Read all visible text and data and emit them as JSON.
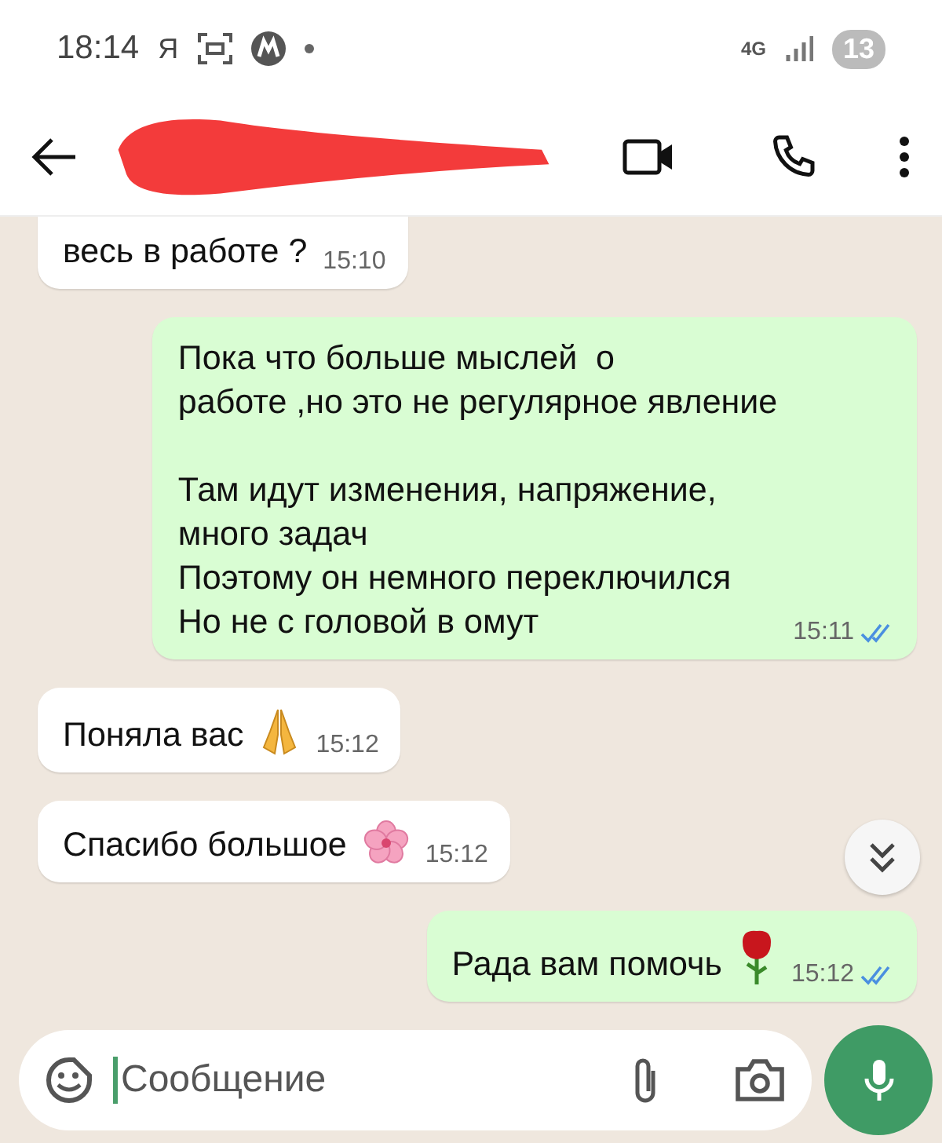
{
  "status_bar": {
    "time": "18:14",
    "carrier": "Я",
    "network": "4G",
    "notifications": "13"
  },
  "header": {
    "contact_redacted": true
  },
  "messages": [
    {
      "kind": "incoming",
      "text": "весь в работе ?",
      "time": "15:10"
    },
    {
      "kind": "outgoing",
      "text": "Пока что больше мыслей  о\nработе ,но это не регулярное явление\n\nТам идут изменения, напряжение,\nмного задач\nПоэтому он немного переключился\nНо не с головой в омут",
      "time": "15:11",
      "read": true
    },
    {
      "kind": "incoming",
      "text": "Поняла вас",
      "time": "15:12",
      "sticker": {
        "kind": "pray"
      }
    },
    {
      "kind": "incoming",
      "text": "Спасибо большое",
      "time": "15:12",
      "sticker": {
        "kind": "blossom"
      }
    },
    {
      "kind": "outgoing",
      "text": "Рада вам помочь",
      "time": "15:12",
      "read": true,
      "sticker": {
        "kind": "rose"
      }
    }
  ],
  "composer": {
    "placeholder": "Сообщение"
  }
}
